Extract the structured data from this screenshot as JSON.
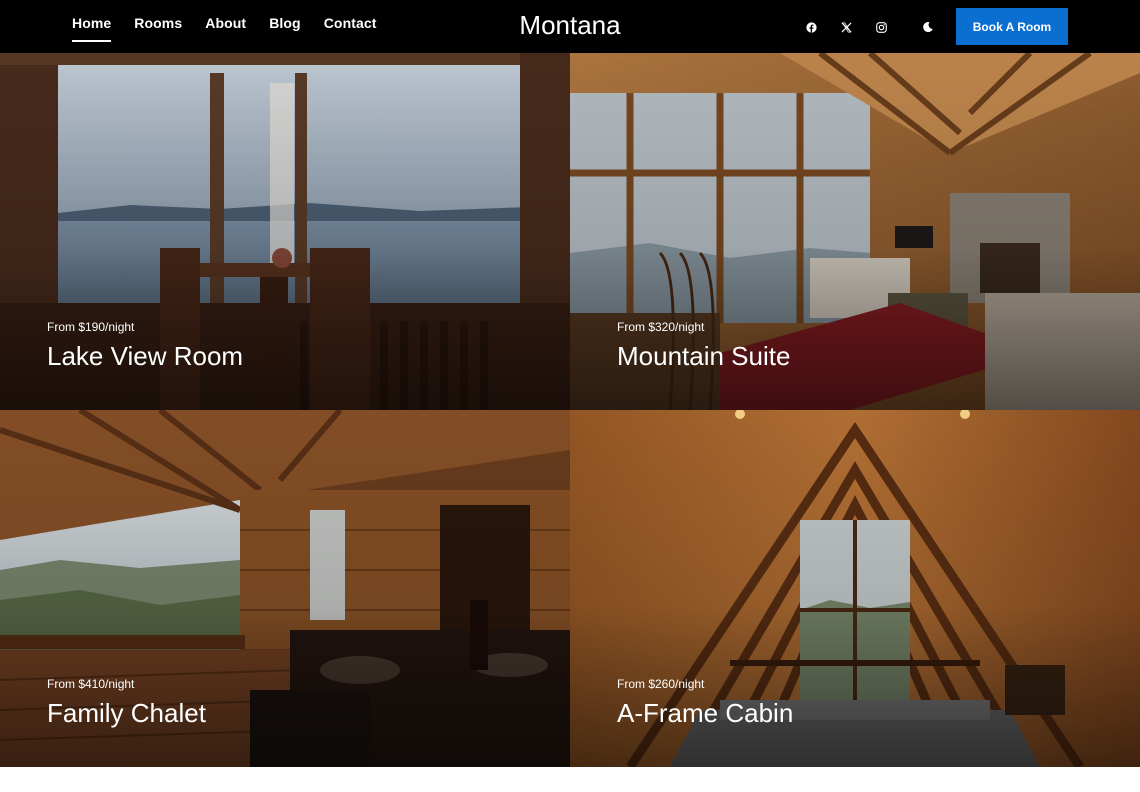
{
  "nav": {
    "links": [
      "Home",
      "Rooms",
      "About",
      "Blog",
      "Contact"
    ],
    "active": "Home",
    "brand": "Montana",
    "icons": [
      "facebook-icon",
      "x-icon",
      "instagram-icon",
      "moon-icon"
    ],
    "book_label": "Book A Room",
    "accent": "#0a6fd0"
  },
  "rooms": [
    {
      "price": "From $190/night",
      "name": "Lake View Room"
    },
    {
      "price": "From $320/night",
      "name": "Mountain Suite"
    },
    {
      "price": "From $410/night",
      "name": "Family Chalet"
    },
    {
      "price": "From $260/night",
      "name": "A-Frame Cabin"
    }
  ]
}
